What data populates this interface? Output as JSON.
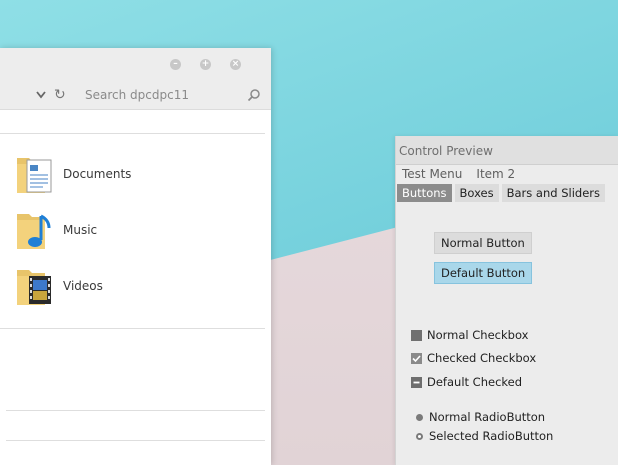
{
  "explorer": {
    "search_placeholder": "Search dpcdpc11",
    "items": [
      {
        "label": "Documents",
        "icon": "documents-folder-icon"
      },
      {
        "label": "Music",
        "icon": "music-folder-icon"
      },
      {
        "label": "Videos",
        "icon": "videos-folder-icon"
      }
    ]
  },
  "preview": {
    "title": "Control Preview",
    "menus": [
      "Test Menu",
      "Item 2"
    ],
    "tabs": [
      "Buttons",
      "Boxes",
      "Bars and Sliders"
    ],
    "buttons": {
      "normal": "Normal Button",
      "default": "Default Button"
    },
    "checkboxes": [
      "Normal Checkbox",
      "Checked Checkbox",
      "Default Checked"
    ],
    "radios": [
      "Normal RadioButton",
      "Selected RadioButton"
    ]
  },
  "colors": {
    "accent": "#a9d7ea",
    "active_tab": "#8c8c8c",
    "sky": "#7fd4de"
  }
}
